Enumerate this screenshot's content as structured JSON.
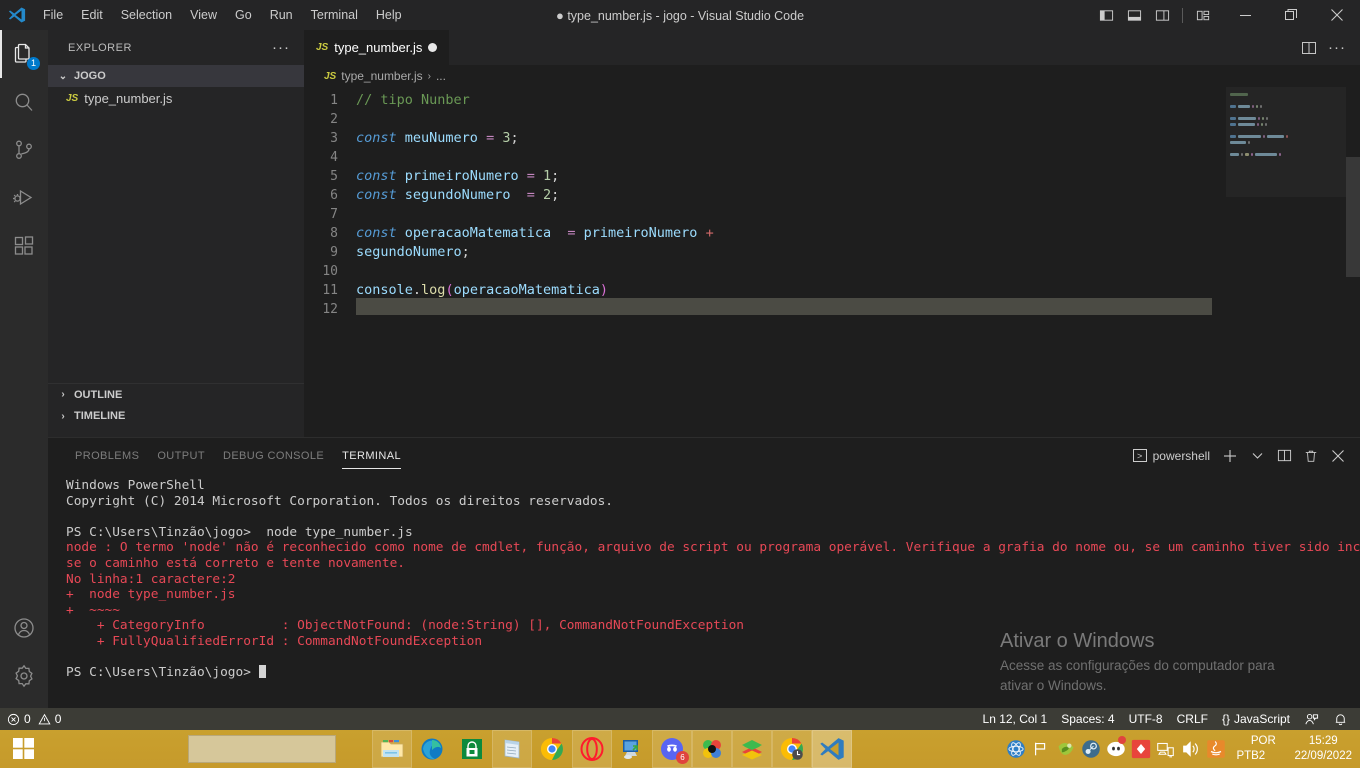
{
  "window": {
    "title": "type_number.js - jogo - Visual Studio Code",
    "dirty_marker": "●",
    "minimize": "—",
    "maximize": "❐",
    "close": "✕"
  },
  "menu": {
    "items": [
      "File",
      "Edit",
      "Selection",
      "View",
      "Go",
      "Run",
      "Terminal",
      "Help"
    ]
  },
  "activity_bar": {
    "items": [
      {
        "name": "explorer",
        "badge": "1"
      },
      {
        "name": "search",
        "badge": ""
      },
      {
        "name": "source-control",
        "badge": ""
      },
      {
        "name": "run-and-debug",
        "badge": ""
      },
      {
        "name": "extensions",
        "badge": ""
      }
    ],
    "bottom": [
      {
        "name": "accounts"
      },
      {
        "name": "manage-settings"
      }
    ]
  },
  "sidebar": {
    "header": "EXPLORER",
    "more_actions": "···",
    "folder": {
      "label": "JOGO",
      "chevron": "⌄"
    },
    "files": [
      {
        "icon": "JS",
        "name": "type_number.js"
      }
    ],
    "sections": [
      {
        "label": "OUTLINE",
        "chevron": "›"
      },
      {
        "label": "TIMELINE",
        "chevron": "›"
      }
    ]
  },
  "editor": {
    "tab": {
      "icon": "JS",
      "label": "type_number.js",
      "dirty": true
    },
    "tab_actions": [
      "split-editor",
      "more-actions"
    ],
    "breadcrumb": {
      "icon": "JS",
      "file": "type_number.js",
      "separator": "›",
      "rest": "..."
    },
    "lines": [
      {
        "n": 1,
        "tokens": [
          {
            "t": "// tipo Nunber",
            "c": "cmt"
          }
        ]
      },
      {
        "n": 2,
        "tokens": []
      },
      {
        "n": 3,
        "tokens": [
          {
            "t": "const",
            "c": "kw"
          },
          {
            "t": " ",
            "c": "op"
          },
          {
            "t": "meuNumero",
            "c": "var-n"
          },
          {
            "t": " ",
            "c": "op"
          },
          {
            "t": "=",
            "c": "eq"
          },
          {
            "t": " ",
            "c": "op"
          },
          {
            "t": "3",
            "c": "num"
          },
          {
            "t": ";",
            "c": "op"
          }
        ]
      },
      {
        "n": 4,
        "tokens": []
      },
      {
        "n": 5,
        "tokens": [
          {
            "t": "const",
            "c": "kw"
          },
          {
            "t": " ",
            "c": "op"
          },
          {
            "t": "primeiroNumero",
            "c": "var-n"
          },
          {
            "t": " ",
            "c": "op"
          },
          {
            "t": "=",
            "c": "eq"
          },
          {
            "t": " ",
            "c": "op"
          },
          {
            "t": "1",
            "c": "num"
          },
          {
            "t": ";",
            "c": "op"
          }
        ]
      },
      {
        "n": 6,
        "tokens": [
          {
            "t": "const",
            "c": "kw"
          },
          {
            "t": " ",
            "c": "op"
          },
          {
            "t": "segundoNumero",
            "c": "var-n"
          },
          {
            "t": "  ",
            "c": "op"
          },
          {
            "t": "=",
            "c": "eq"
          },
          {
            "t": " ",
            "c": "op"
          },
          {
            "t": "2",
            "c": "num"
          },
          {
            "t": ";",
            "c": "op"
          }
        ]
      },
      {
        "n": 7,
        "tokens": []
      },
      {
        "n": 8,
        "tokens": [
          {
            "t": "const",
            "c": "kw"
          },
          {
            "t": " ",
            "c": "op"
          },
          {
            "t": "operacaoMatematica",
            "c": "var-n"
          },
          {
            "t": "  ",
            "c": "op"
          },
          {
            "t": "=",
            "c": "eq"
          },
          {
            "t": " ",
            "c": "op"
          },
          {
            "t": "primeiroNumero",
            "c": "var-n"
          },
          {
            "t": " ",
            "c": "op"
          },
          {
            "t": "+",
            "c": "plus"
          }
        ]
      },
      {
        "n": 9,
        "tokens": [
          {
            "t": "segundoNumero",
            "c": "var-n"
          },
          {
            "t": ";",
            "c": "op"
          }
        ]
      },
      {
        "n": 10,
        "tokens": []
      },
      {
        "n": 11,
        "tokens": [
          {
            "t": "console",
            "c": "var-n"
          },
          {
            "t": ".",
            "c": "op"
          },
          {
            "t": "log",
            "c": "fn"
          },
          {
            "t": "(",
            "c": "paren"
          },
          {
            "t": "operacaoMatematica",
            "c": "var-n"
          },
          {
            "t": ")",
            "c": "paren"
          }
        ]
      },
      {
        "n": 12,
        "tokens": [],
        "current": true
      }
    ]
  },
  "panel": {
    "tabs": [
      {
        "label": "PROBLEMS",
        "active": false
      },
      {
        "label": "OUTPUT",
        "active": false
      },
      {
        "label": "DEBUG CONSOLE",
        "active": false
      },
      {
        "label": "TERMINAL",
        "active": true
      }
    ],
    "shell_label": "powershell",
    "actions": [
      "new-terminal",
      "chevron-down",
      "split-terminal",
      "kill-terminal",
      "close-panel"
    ],
    "terminal_lines": [
      {
        "text": "Windows PowerShell",
        "color": "white"
      },
      {
        "text": "Copyright (C) 2014 Microsoft Corporation. Todos os direitos reservados.",
        "color": "white"
      },
      {
        "text": "",
        "color": "white"
      },
      {
        "text": "PS C:\\Users\\Tinzão\\jogo>  node type_number.js",
        "color": "white"
      },
      {
        "text": "node : O termo 'node' não é reconhecido como nome de cmdlet, função, arquivo de script ou programa operável. Verifique a grafia do nome ou, se um caminho tiver sido incluído, veja",
        "color": "red"
      },
      {
        "text": "se o caminho está correto e tente novamente.",
        "color": "red"
      },
      {
        "text": "No linha:1 caractere:2",
        "color": "red"
      },
      {
        "text": "+  node type_number.js",
        "color": "red"
      },
      {
        "text": "+  ~~~~",
        "color": "red"
      },
      {
        "text": "    + CategoryInfo          : ObjectNotFound: (node:String) [], CommandNotFoundException",
        "color": "red"
      },
      {
        "text": "    + FullyQualifiedErrorId : CommandNotFoundException",
        "color": "red"
      },
      {
        "text": "",
        "color": "white"
      },
      {
        "text": "PS C:\\Users\\Tinzão\\jogo> ",
        "color": "white",
        "caret": true
      }
    ]
  },
  "watermark": {
    "title": "Ativar o Windows",
    "line1": "Acesse as configurações do computador para",
    "line2": "ativar o Windows."
  },
  "status_bar": {
    "errors": "0",
    "warnings": "0",
    "position": "Ln 12, Col 1",
    "indentation": "Spaces: 4",
    "encoding": "UTF-8",
    "eol": "CRLF",
    "language": "JavaScript",
    "language_icon": "{}",
    "feedback_icon": "remote-feedback",
    "bell_icon": "notifications"
  },
  "taskbar": {
    "start": "windows-logo",
    "search_placeholder": "",
    "pinned": [
      {
        "name": "file-explorer"
      },
      {
        "name": "microsoft-edge"
      },
      {
        "name": "microsoft-store"
      },
      {
        "name": "notepad"
      },
      {
        "name": "google-chrome"
      },
      {
        "name": "opera"
      },
      {
        "name": "remote-desktop"
      },
      {
        "name": "discord",
        "badge": "6"
      },
      {
        "name": "xmind"
      },
      {
        "name": "bluestacks"
      },
      {
        "name": "chrome-secondary"
      },
      {
        "name": "visual-studio-code",
        "active": true
      }
    ],
    "tray": [
      {
        "name": "react-devtools"
      },
      {
        "name": "flag"
      },
      {
        "name": "winrar"
      },
      {
        "name": "steam"
      },
      {
        "name": "discord-tray"
      },
      {
        "name": "red-app"
      },
      {
        "name": "network"
      },
      {
        "name": "volume"
      },
      {
        "name": "java"
      }
    ],
    "language_top": "POR",
    "language_bottom": "PTB2",
    "time": "15:29",
    "date": "22/09/2022"
  },
  "colors": {
    "accent": "#007acc",
    "editor_bg": "#1e1e1e",
    "sidebar_bg": "#252526",
    "status_bg": "#3c3c36",
    "error_red": "#e74856",
    "taskbar": "#c69a2b"
  }
}
